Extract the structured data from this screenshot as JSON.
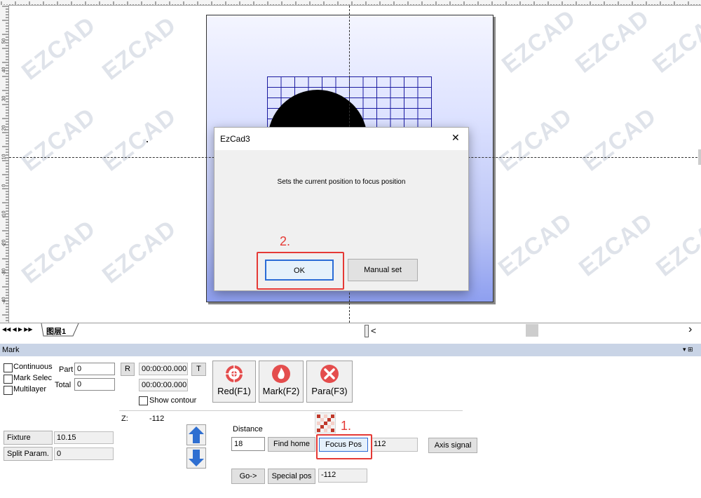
{
  "ruler_left_labels": [
    "50",
    "40",
    "30",
    "20",
    "10",
    "0",
    "-10",
    "-20",
    "-30",
    "-40",
    "-50"
  ],
  "watermark": "EZCAD",
  "dialog": {
    "title": "EzCad3",
    "message": "Sets the current position to focus position",
    "ok_label": "OK",
    "manual_label": "Manual set",
    "close_glyph": "✕"
  },
  "annotations": {
    "step1": "1.",
    "step2": "2.",
    "color": "#e53935"
  },
  "tabs": {
    "nav": "◀◀ ◀ ▶ ▶▶",
    "layer_tab": "图层1",
    "scroll_right": "›",
    "scroll_left": "<"
  },
  "mark_panel": {
    "title": "Mark",
    "header_icons": "▾ ⊞",
    "continuous_label": "Continuous",
    "mark_select_label": "Mark Selec",
    "multilayer_label": "Multilayer",
    "part_label": "Part",
    "part_value": "0",
    "total_label": "Total",
    "total_value": "0",
    "r_label": "R",
    "time1": "00:00:00.000",
    "t_label": "T",
    "time2": "00:00:00.000",
    "show_contour_label": "Show contour",
    "red_label": "Red(F1)",
    "mark_label": "Mark(F2)",
    "para_label": "Para(F3)",
    "z_label": "Z:",
    "z_value": "-112",
    "fixture_offset_label": "Fixture Offset",
    "fixture_offset_value": "10.15",
    "split_param_label": "Split Param.",
    "split_param_value": "0",
    "distance_label": "Distance",
    "distance_value": "18",
    "find_home_label": "Find home",
    "focus_pos_label": "Focus Pos",
    "focus_pos_value": "112",
    "axis_signal_label": "Axis signal",
    "go_label": "Go->",
    "special_pos_label": "Special pos",
    "special_pos_value": "-112"
  },
  "colors": {
    "accent": "#2b6cd6",
    "panel_header": "#c9d4e6"
  }
}
